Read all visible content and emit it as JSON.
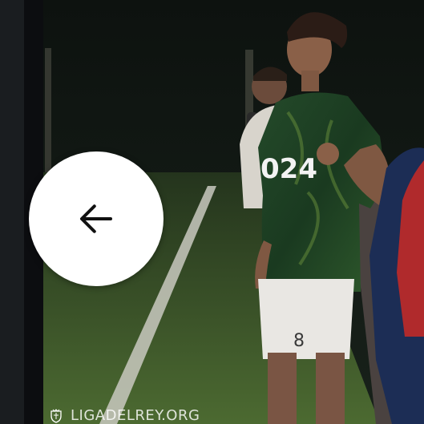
{
  "back_button": {
    "label": "",
    "icon": "arrow-left-icon"
  },
  "watermark": {
    "text": "LIGADELREY.ORG",
    "logo": "crest-icon"
  },
  "jersey": {
    "text": "024",
    "shorts_number": "8"
  },
  "colors": {
    "turf": "#3f5a2a",
    "jersey": "#1f3a22",
    "button": "#ffffff"
  }
}
